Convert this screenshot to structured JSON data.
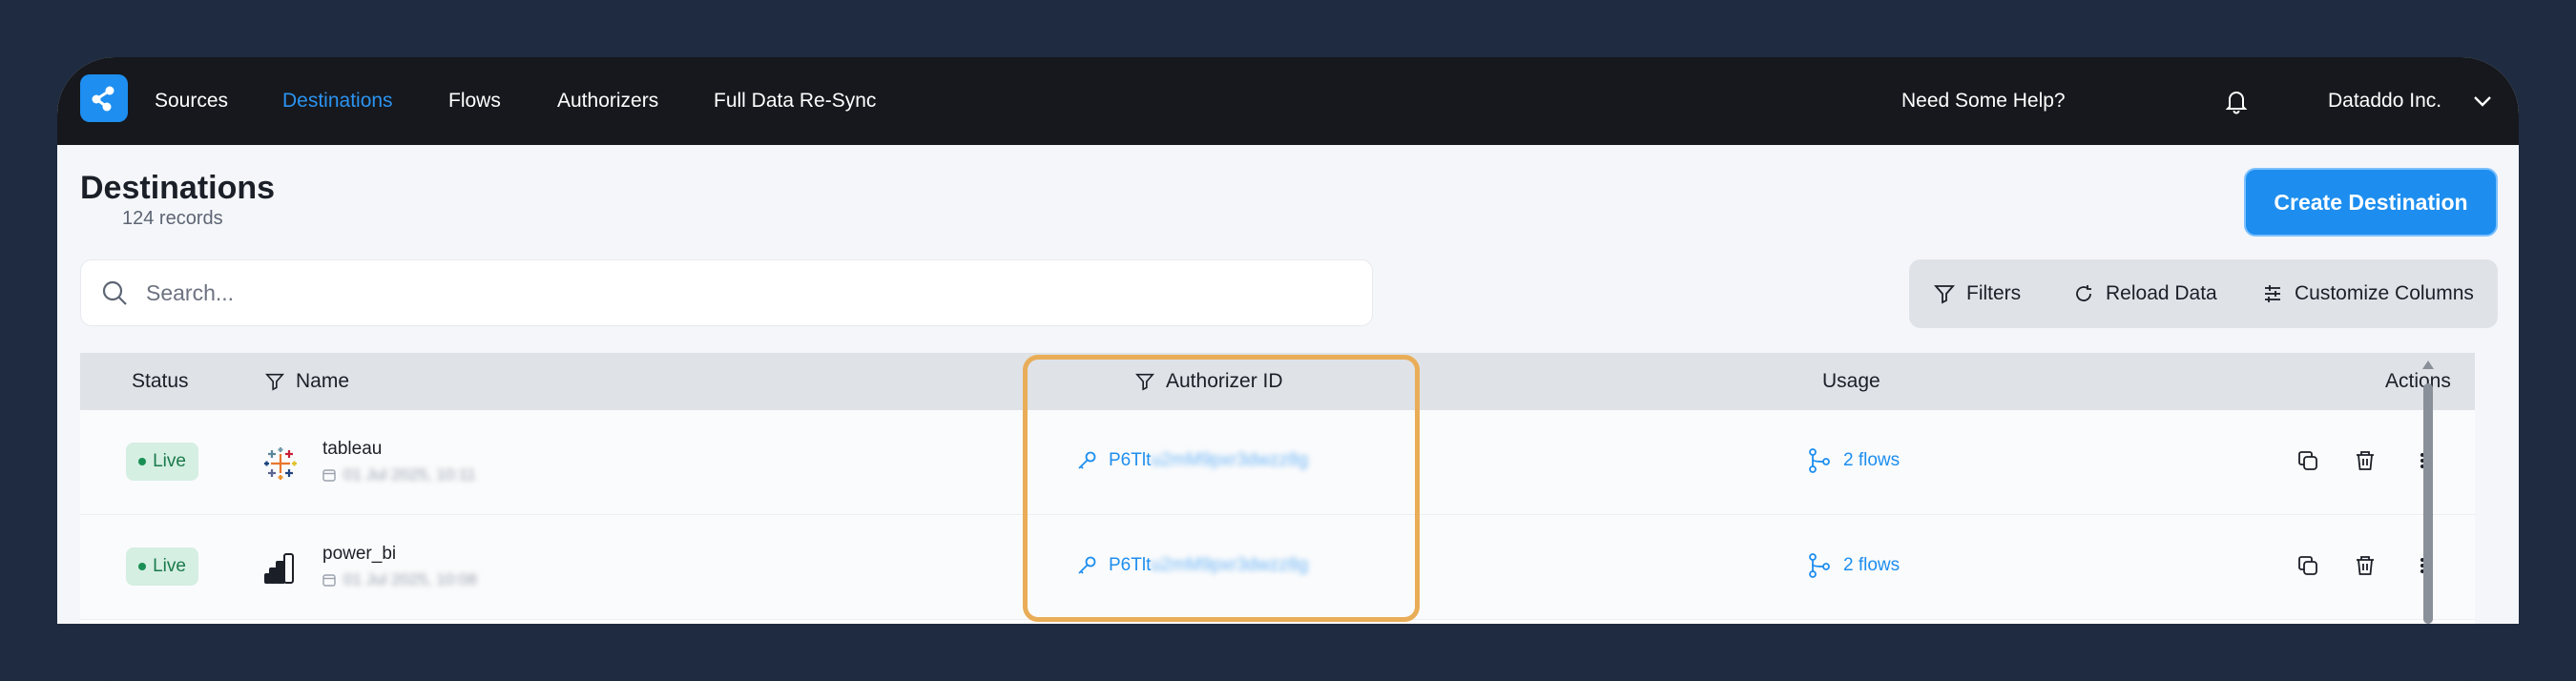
{
  "nav": {
    "items": [
      {
        "label": "Sources",
        "active": false
      },
      {
        "label": "Destinations",
        "active": true
      },
      {
        "label": "Flows",
        "active": false
      },
      {
        "label": "Authorizers",
        "active": false
      },
      {
        "label": "Full Data Re-Sync",
        "active": false
      }
    ],
    "help": "Need Some Help?",
    "org": "Dataddo Inc."
  },
  "header": {
    "title": "Destinations",
    "count": "124 records",
    "create_button": "Create Destination"
  },
  "search": {
    "placeholder": "Search...",
    "value": ""
  },
  "toolbar": {
    "filters": "Filters",
    "reload": "Reload Data",
    "customize": "Customize Columns"
  },
  "table": {
    "columns": {
      "status": "Status",
      "name": "Name",
      "authorizer": "Authorizer ID",
      "usage": "Usage",
      "actions": "Actions"
    },
    "rows": [
      {
        "status": "Live",
        "name": "tableau",
        "icon": "tableau-logo-icon",
        "date": "01 Jul 2025, 10:11",
        "authorizer_prefix": "P6Tlt",
        "authorizer_rest": "u2mM9pxr3dwzz8g",
        "usage": "2 flows"
      },
      {
        "status": "Live",
        "name": "power_bi",
        "icon": "powerbi-logo-icon",
        "date": "01 Jul 2025, 10:08",
        "authorizer_prefix": "P6Tlt",
        "authorizer_rest": "u2mM9pxr3dwzz8g",
        "usage": "2 flows"
      }
    ]
  },
  "colors": {
    "accent": "#1d8eef",
    "nav_bg": "#16181d",
    "live_bg": "#d5efe2",
    "live_text": "#1a7a4b",
    "highlight": "#e9ad58"
  }
}
